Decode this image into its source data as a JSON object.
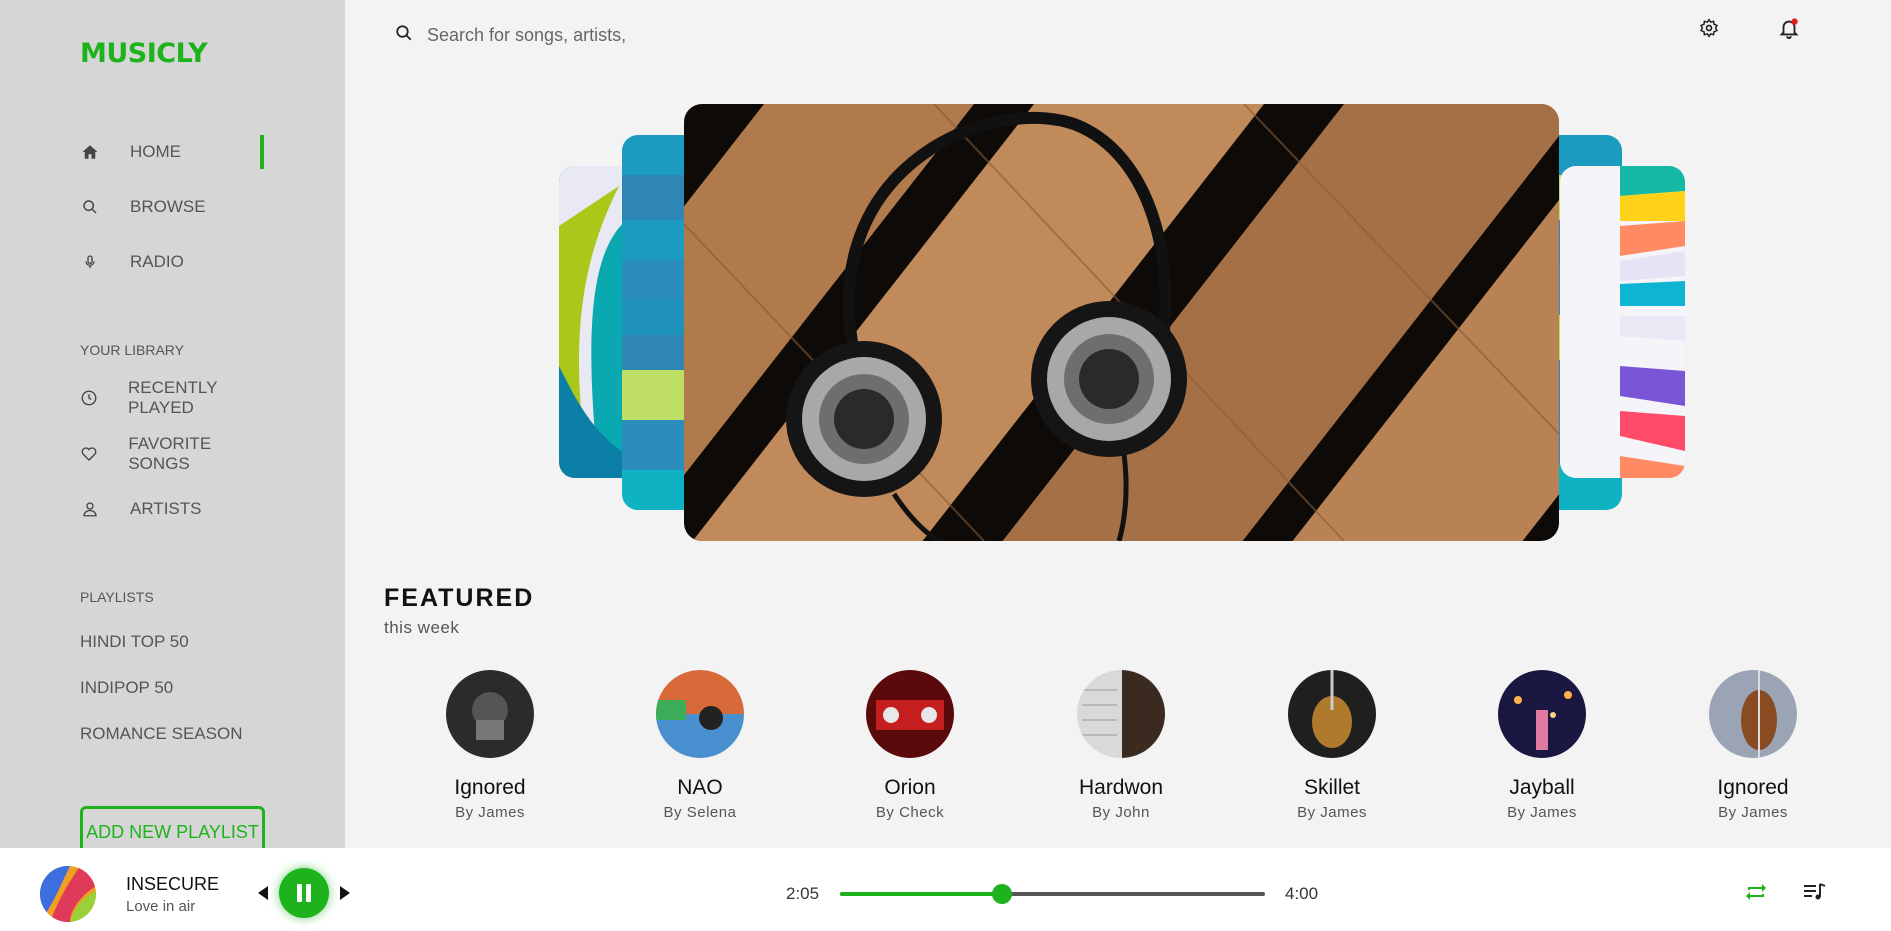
{
  "app": {
    "logo": "MUSICLY"
  },
  "sidebar": {
    "nav": [
      {
        "label": "HOME",
        "icon": "home-icon"
      },
      {
        "label": "BROWSE",
        "icon": "search-icon"
      },
      {
        "label": "RADIO",
        "icon": "microphone-icon"
      }
    ],
    "library_title": "YOUR LIBRARY",
    "library": [
      {
        "label": "RECENTLY PLAYED",
        "icon": "clock-icon"
      },
      {
        "label": "FAVORITE SONGS",
        "icon": "heart-icon"
      },
      {
        "label": "ARTISTS",
        "icon": "user-icon"
      }
    ],
    "playlists_title": "PLAYLISTS",
    "playlists": [
      "HINDI TOP 50",
      "INDIPOP 50",
      "ROMANCE SEASON"
    ],
    "add_playlist_label": "ADD NEW PLAYLIST"
  },
  "search": {
    "placeholder": "Search for songs, artists,"
  },
  "featured": {
    "title": "FEATURED",
    "subtitle": "this week",
    "artists": [
      {
        "name": "Ignored",
        "by": "By James"
      },
      {
        "name": "NAO",
        "by": "By Selena"
      },
      {
        "name": "Orion",
        "by": "By Check"
      },
      {
        "name": "Hardwon",
        "by": "By John"
      },
      {
        "name": "Skillet",
        "by": "By James"
      },
      {
        "name": "Jayball",
        "by": "By James"
      },
      {
        "name": "Ignored",
        "by": "By James"
      }
    ]
  },
  "player": {
    "title": "INSECURE",
    "subtitle": "Love in air",
    "current_time": "2:05",
    "total_time": "4:00",
    "progress": 0.38
  },
  "colors": {
    "accent": "#1db31d",
    "sidebar": "#d6d6d6",
    "notification_dot": "#e02020"
  }
}
